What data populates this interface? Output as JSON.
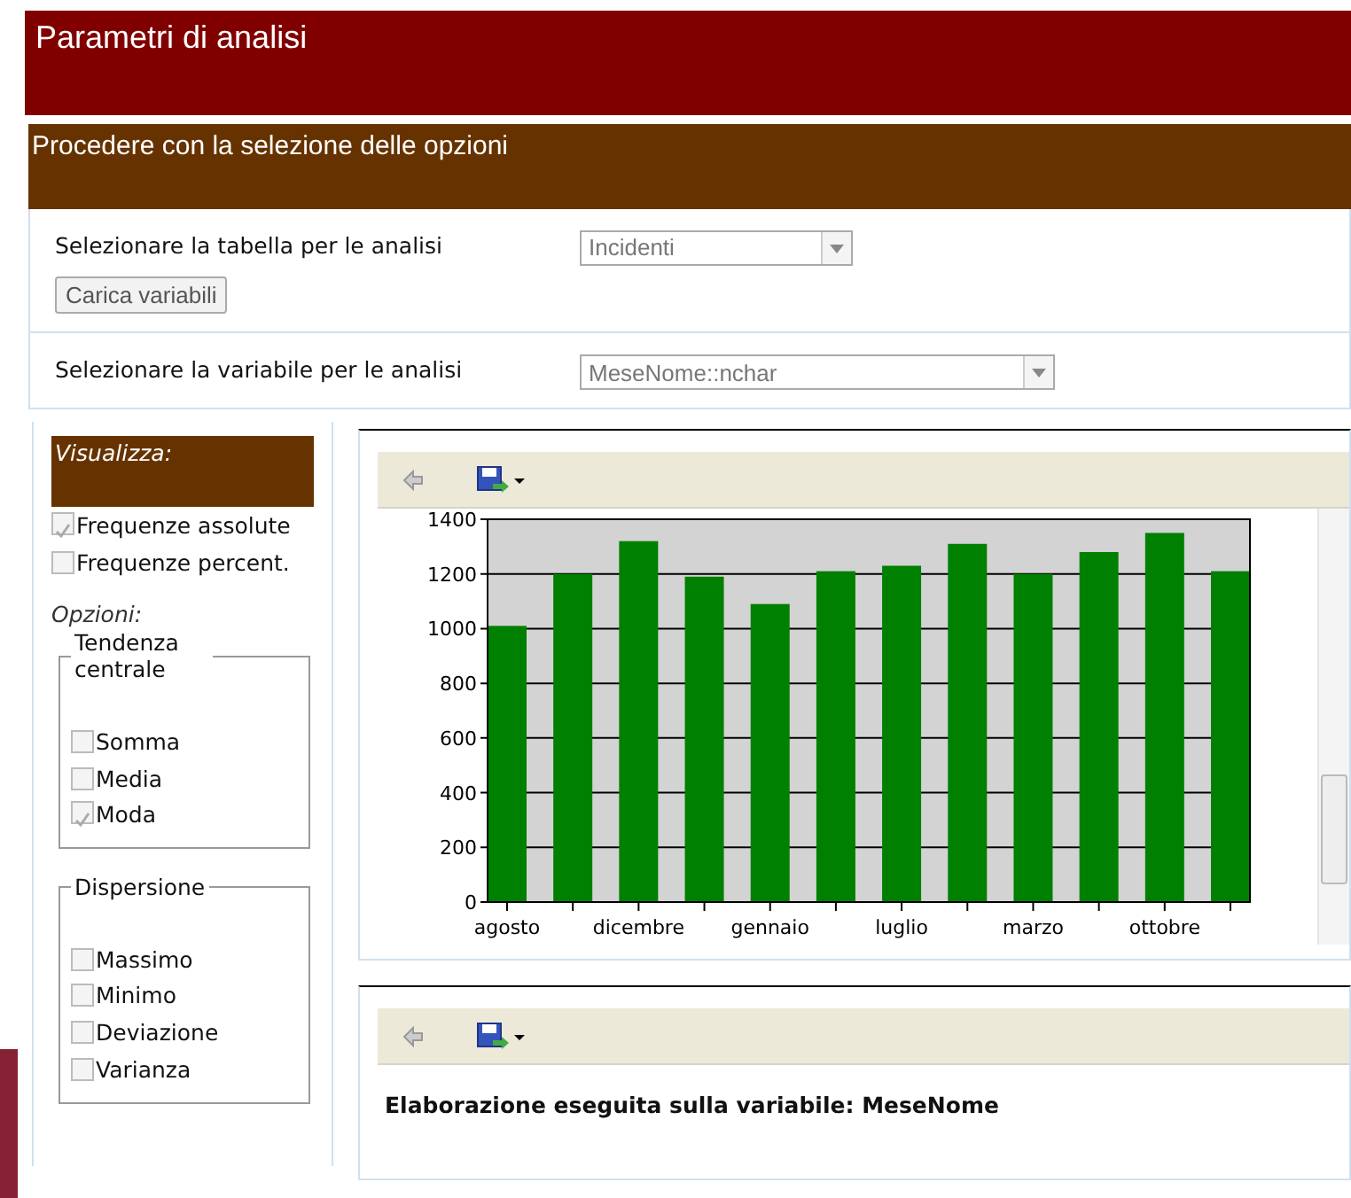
{
  "header": {
    "title": "Parametri di analisi"
  },
  "section": {
    "title": "Procedere con la selezione delle opzioni"
  },
  "table_select": {
    "label": "Selezionare la tabella per le analisi",
    "value": "Incidenti"
  },
  "load_button": {
    "label": "Carica variabili"
  },
  "variable_select": {
    "label": "Selezionare la variabile per le analisi",
    "value": "MeseNome::nchar"
  },
  "sidebar": {
    "heading": "Visualizza:",
    "display_options": [
      {
        "label": "Frequenze assolute",
        "checked": true
      },
      {
        "label": "Frequenze percent.",
        "checked": false
      }
    ],
    "options_label": "Opzioni:",
    "groups": [
      {
        "title": "Tendenza centrale",
        "items": [
          {
            "label": "Somma",
            "checked": false
          },
          {
            "label": "Media",
            "checked": false
          },
          {
            "label": "Moda",
            "checked": true
          }
        ]
      },
      {
        "title": "Dispersione",
        "items": [
          {
            "label": "Massimo",
            "checked": false
          },
          {
            "label": "Minimo",
            "checked": false
          },
          {
            "label": "Deviazione",
            "checked": false
          },
          {
            "label": "Varianza",
            "checked": false
          }
        ]
      }
    ]
  },
  "chart_panel": {
    "chart_data": {
      "type": "bar",
      "categories": [
        "agosto",
        null,
        "dicembre",
        null,
        "gennaio",
        null,
        "luglio",
        null,
        "marzo",
        null,
        "ottobre",
        null
      ],
      "series": [
        {
          "color": "#008000",
          "values": [
            1010,
            1200,
            1320,
            1190,
            1090,
            1210,
            1230,
            1310,
            1200,
            1280,
            1350,
            1210
          ]
        }
      ],
      "grid": true,
      "ylim": [
        0,
        1400
      ],
      "yticks": [
        0,
        200,
        400,
        600,
        800,
        1000,
        1200,
        1400
      ]
    }
  },
  "result_panel": {
    "message": "Elaborazione eseguita sulla variabile: MeseNome"
  }
}
